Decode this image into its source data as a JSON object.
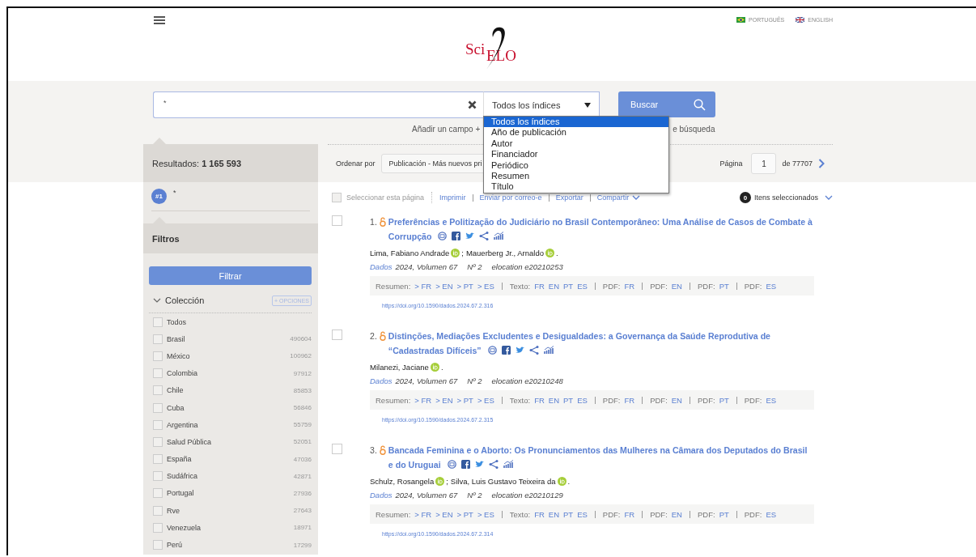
{
  "header": {
    "logo": [
      "Sci",
      "ELO"
    ],
    "languages": [
      {
        "label": "PORTUGUÊS",
        "kind": "br"
      },
      {
        "label": "ENGLISH",
        "kind": "uk"
      }
    ]
  },
  "search": {
    "value": "*",
    "index_select": "Todos los índices",
    "button": "Buscar",
    "add_field": "Añadir un campo +",
    "hint_tail": "e búsqueda",
    "dropdown": {
      "expanded": true,
      "options": [
        {
          "label": "Todos los índices",
          "selected": true
        },
        {
          "label": "Año de publicación",
          "selected": false
        },
        {
          "label": "Autor",
          "selected": false
        },
        {
          "label": "Financiador",
          "selected": false
        },
        {
          "label": "Periódico",
          "selected": false
        },
        {
          "label": "Resumen",
          "selected": false
        },
        {
          "label": "Título",
          "selected": false
        }
      ]
    }
  },
  "results_summary": {
    "label": "Resultados:",
    "count": "1 165 593"
  },
  "sort": {
    "label": "Ordenar por",
    "value": "Publicación - Más nuevos pri"
  },
  "pagination": {
    "label": "Página",
    "page": "1",
    "total": "de 77707"
  },
  "query": {
    "badge": "#1",
    "text": "*"
  },
  "filters": {
    "title": "Filtros",
    "button": "Filtrar",
    "group": {
      "title": "Colección",
      "expanded": true,
      "options_button": "+ OPCIONES",
      "items": [
        {
          "label": "Todos",
          "checked": false
        },
        {
          "label": "Brasil",
          "count": "490604",
          "checked": false
        },
        {
          "label": "México",
          "count": "100962",
          "checked": false
        },
        {
          "label": "Colombia",
          "count": "97912",
          "checked": false
        },
        {
          "label": "Chile",
          "count": "85853",
          "checked": false
        },
        {
          "label": "Cuba",
          "count": "56846",
          "checked": false
        },
        {
          "label": "Argentina",
          "count": "55759",
          "checked": false
        },
        {
          "label": "Salud Pública",
          "count": "52051",
          "checked": false
        },
        {
          "label": "España",
          "count": "47036",
          "checked": false
        },
        {
          "label": "Sudáfrica",
          "count": "42871",
          "checked": false
        },
        {
          "label": "Portugal",
          "count": "27936",
          "checked": false
        },
        {
          "label": "Rve",
          "count": "27643",
          "checked": false
        },
        {
          "label": "Venezuela",
          "count": "18971",
          "checked": false
        },
        {
          "label": "Perú",
          "count": "17299",
          "checked": false
        }
      ]
    }
  },
  "toolbar": {
    "select_page": "Seleccionar esta página",
    "select_page_checked": false,
    "actions": [
      "Imprimir",
      "Enviar por correo-e",
      "Exportar",
      "Compartir"
    ],
    "selected_count": "0",
    "selected_label": "Itens seleccionados"
  },
  "results": [
    {
      "number": "1.",
      "checked": false,
      "open_access": true,
      "title": "Preferências e Politização do Judiciário no Brasil Contemporâneo: Uma Análise de Casos de Combate à Corrupção",
      "authors": [
        {
          "name": "Lima, Fabiano Andrade",
          "orcid": true,
          "after": ";"
        },
        {
          "name": "Mauerberg Jr., Arnaldo",
          "orcid": true,
          "after": "."
        }
      ],
      "source": {
        "journal": "Dados",
        "details": [
          "2024, Volumen 67",
          "Nº 2",
          "elocation e20210253"
        ]
      },
      "link_groups": [
        {
          "label": "Resumen:",
          "links": [
            "> FR",
            "> EN",
            "> PT",
            "> ES"
          ]
        },
        {
          "label": "Texto:",
          "links": [
            "FR",
            "EN",
            "PT",
            "ES"
          ]
        },
        {
          "label": "PDF:",
          "links": [
            "FR"
          ]
        },
        {
          "label": "PDF:",
          "links": [
            "EN"
          ]
        },
        {
          "label": "PDF:",
          "links": [
            "PT"
          ]
        },
        {
          "label": "PDF:",
          "links": [
            "ES"
          ]
        }
      ],
      "doi": "https://doi.org/10.1590/dados.2024.67.2.316"
    },
    {
      "number": "2.",
      "checked": false,
      "open_access": true,
      "title": "Distinções, Mediações Excludentes e Desigualdades: a Governança da Saúde Reprodutiva de “Cadastradas Difíceis”",
      "authors": [
        {
          "name": "Milanezi, Jaciane",
          "orcid": true,
          "after": "."
        }
      ],
      "source": {
        "journal": "Dados",
        "details": [
          "2024, Volumen 67",
          "Nº 2",
          "elocation e20210248"
        ]
      },
      "link_groups": [
        {
          "label": "Resumen:",
          "links": [
            "> FR",
            "> EN",
            "> PT",
            "> ES"
          ]
        },
        {
          "label": "Texto:",
          "links": [
            "FR",
            "EN",
            "PT",
            "ES"
          ]
        },
        {
          "label": "PDF:",
          "links": [
            "FR"
          ]
        },
        {
          "label": "PDF:",
          "links": [
            "EN"
          ]
        },
        {
          "label": "PDF:",
          "links": [
            "PT"
          ]
        },
        {
          "label": "PDF:",
          "links": [
            "ES"
          ]
        }
      ],
      "doi": "https://doi.org/10.1590/dados.2024.67.2.315"
    },
    {
      "number": "3.",
      "checked": false,
      "open_access": true,
      "title": "Bancada Feminina e o Aborto: Os Pronunciamentos das Mulheres na Câmara dos Deputados do Brasil e do Uruguai",
      "authors": [
        {
          "name": "Schulz, Rosangela",
          "orcid": true,
          "after": ";"
        },
        {
          "name": "Silva, Luis Gustavo Teixeira da",
          "orcid": true,
          "after": "."
        }
      ],
      "source": {
        "journal": "Dados",
        "details": [
          "2024, Volumen 67",
          "Nº 2",
          "elocation e20210129"
        ]
      },
      "link_groups": [
        {
          "label": "Resumen:",
          "links": [
            "> FR",
            "> EN",
            "> PT",
            "> ES"
          ]
        },
        {
          "label": "Texto:",
          "links": [
            "FR",
            "EN",
            "PT",
            "ES"
          ]
        },
        {
          "label": "PDF:",
          "links": [
            "FR"
          ]
        },
        {
          "label": "PDF:",
          "links": [
            "EN"
          ]
        },
        {
          "label": "PDF:",
          "links": [
            "PT"
          ]
        },
        {
          "label": "PDF:",
          "links": [
            "ES"
          ]
        }
      ],
      "doi": "https://doi.org/10.1590/dados.2024.67.2.314"
    }
  ]
}
